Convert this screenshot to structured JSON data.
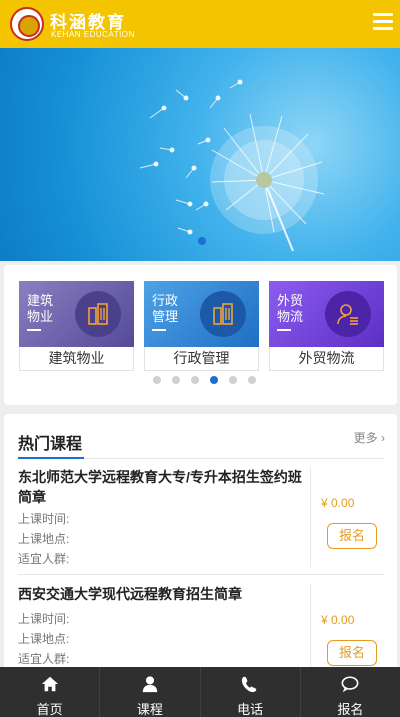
{
  "header": {
    "brand": "科涵教育",
    "brand_en": "KEHAN EDUCATION",
    "menu_icon": "hamburger-menu-icon"
  },
  "banner": {
    "image": "dandelion-blue-sky",
    "active_slide": 1,
    "slide_count": 1
  },
  "categories": {
    "items": [
      {
        "title": "建筑物业",
        "label": "建筑物业",
        "icon": "building-icon",
        "color": "#6c5fa8"
      },
      {
        "title": "行政管理",
        "label": "行政管理",
        "icon": "building-icon",
        "color": "#2f86d6"
      },
      {
        "title": "外贸物流",
        "label": "外贸物流",
        "icon": "person-list-icon",
        "color": "#6e3fd4"
      }
    ],
    "page_count": 6,
    "active_page": 4
  },
  "courses": {
    "title": "热门课程",
    "more": "更多",
    "items": [
      {
        "name": "东北师范大学远程教育大专/专升本招生签约班简章",
        "time_label": "上课时间:",
        "place_label": "上课地点:",
        "audience_label": "适宜人群:",
        "price": "¥ 0.00",
        "signup": "报名"
      },
      {
        "name": "西安交通大学现代远程教育招生简章",
        "time_label": "上课时间:",
        "place_label": "上课地点:",
        "audience_label": "适宜人群:",
        "price": "¥ 0.00",
        "signup": "报名"
      }
    ]
  },
  "tabbar": {
    "items": [
      {
        "label": "首页",
        "icon": "home-icon"
      },
      {
        "label": "课程",
        "icon": "user-icon"
      },
      {
        "label": "电话",
        "icon": "phone-icon"
      },
      {
        "label": "报名",
        "icon": "chat-icon"
      }
    ]
  }
}
